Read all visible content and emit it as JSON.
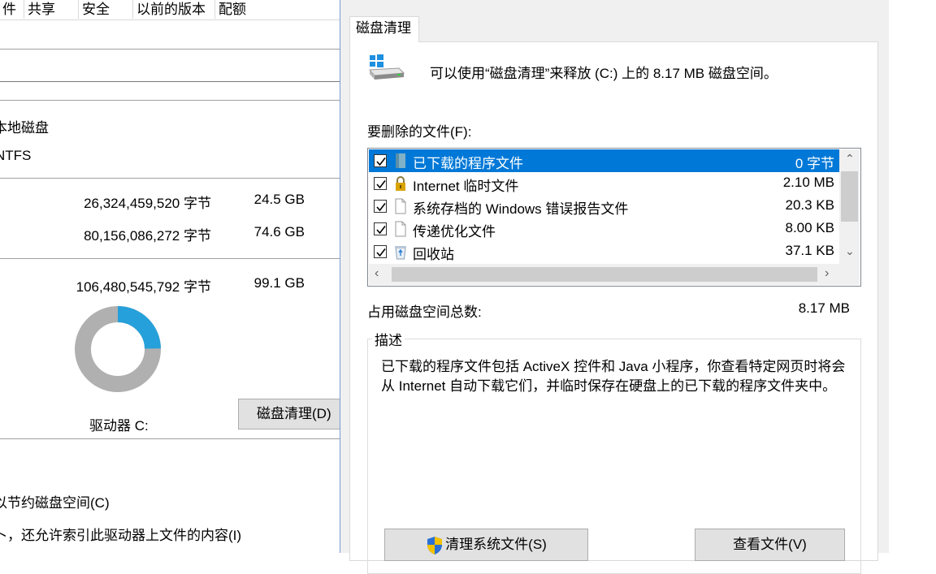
{
  "left_window": {
    "tabs": [
      "件",
      "共享",
      "安全",
      "以前的版本",
      "配额"
    ],
    "type_value": "本地磁盘",
    "filesystem_value": "NTFS",
    "used": {
      "bytes": "26,324,459,520 字节",
      "size": "24.5 GB"
    },
    "free": {
      "bytes": "80,156,086,272 字节",
      "size": "74.6 GB"
    },
    "capacity": {
      "bytes": "106,480,545,792 字节",
      "size": "99.1 GB"
    },
    "usage_chart": {
      "used_fraction": 0.247,
      "used_color": "#26a0da",
      "free_color": "#b0b0b0"
    },
    "drive_label": "驱动器 C:",
    "disk_cleanup_button": "磁盘清理(D)",
    "compress_option": "以节约磁盘空间(C)",
    "index_option": "卜，还允许索引此驱动器上文件的内容(I)"
  },
  "dialog": {
    "tab_label": "磁盘清理",
    "intro": "可以使用“磁盘清理”来释放 (C:) 上的 8.17 MB 磁盘空间。",
    "files_label": "要删除的文件(F):",
    "files": [
      {
        "name": "已下载的程序文件",
        "size": "0 字节",
        "checked": true,
        "selected": true,
        "icon": "folder-icon"
      },
      {
        "name": "Internet 临时文件",
        "size": "2.10 MB",
        "checked": true,
        "selected": false,
        "icon": "lock-icon"
      },
      {
        "name": "系统存档的 Windows 错误报告文件",
        "size": "20.3 KB",
        "checked": true,
        "selected": false,
        "icon": "document-icon"
      },
      {
        "name": "传递优化文件",
        "size": "8.00 KB",
        "checked": true,
        "selected": false,
        "icon": "document-icon"
      },
      {
        "name": "回收站",
        "size": "37.1 KB",
        "checked": true,
        "selected": false,
        "icon": "recycle-bin-icon"
      }
    ],
    "total_label": "占用磁盘空间总数:",
    "total_value": "8.17 MB",
    "description_legend": "描述",
    "description": "已下载的程序文件包括 ActiveX 控件和 Java 小程序，你查看特定网页时将会从 Internet 自动下载它们，并临时保存在硬盘上的已下载的程序文件夹中。",
    "clean_system_button": "清理系统文件(S)",
    "view_files_button": "查看文件(V)",
    "accent_color": "#0078d7"
  }
}
